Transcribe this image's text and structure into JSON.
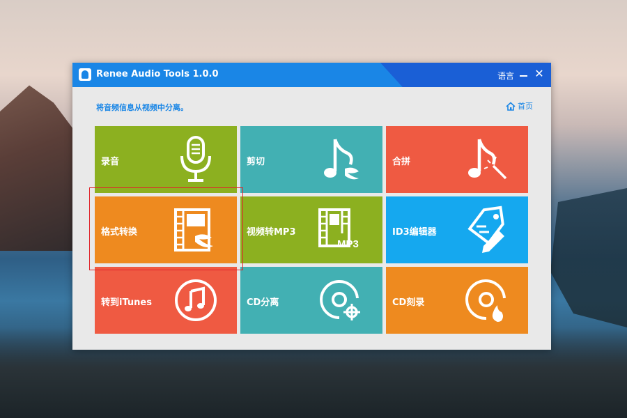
{
  "window": {
    "title": "Renee Audio Tools 1.0.0",
    "language_label": "语言",
    "close_glyph": "✕"
  },
  "header": {
    "subtitle": "将音频信息从视频中分离。",
    "home_label": "首页"
  },
  "tiles": [
    {
      "label": "录音",
      "icon": "microphone-icon",
      "color": "#8cb020"
    },
    {
      "label": "剪切",
      "icon": "music-note-cut-icon",
      "color": "#42b0b3"
    },
    {
      "label": "合拼",
      "icon": "music-note-merge-icon",
      "color": "#ef5a42"
    },
    {
      "label": "格式转换",
      "icon": "film-convert-icon",
      "color": "#ee8a1f"
    },
    {
      "label": "视频转MP3",
      "icon": "film-mp3-icon",
      "color": "#8cb020",
      "icon_text": "MP3"
    },
    {
      "label": "ID3编辑器",
      "icon": "tag-edit-icon",
      "color": "#15a8ef"
    },
    {
      "label": "转到iTunes",
      "icon": "itunes-note-icon",
      "color": "#ef5a42"
    },
    {
      "label": "CD分离",
      "icon": "cd-split-icon",
      "color": "#42b0b3"
    },
    {
      "label": "CD刻录",
      "icon": "cd-burn-icon",
      "color": "#ee8a1f"
    }
  ],
  "colors": {
    "titlebar": "#1a86e6",
    "titlebar_dark": "#1a5fd6",
    "accent": "#1a86e6",
    "highlight_box": "#e0252b"
  }
}
